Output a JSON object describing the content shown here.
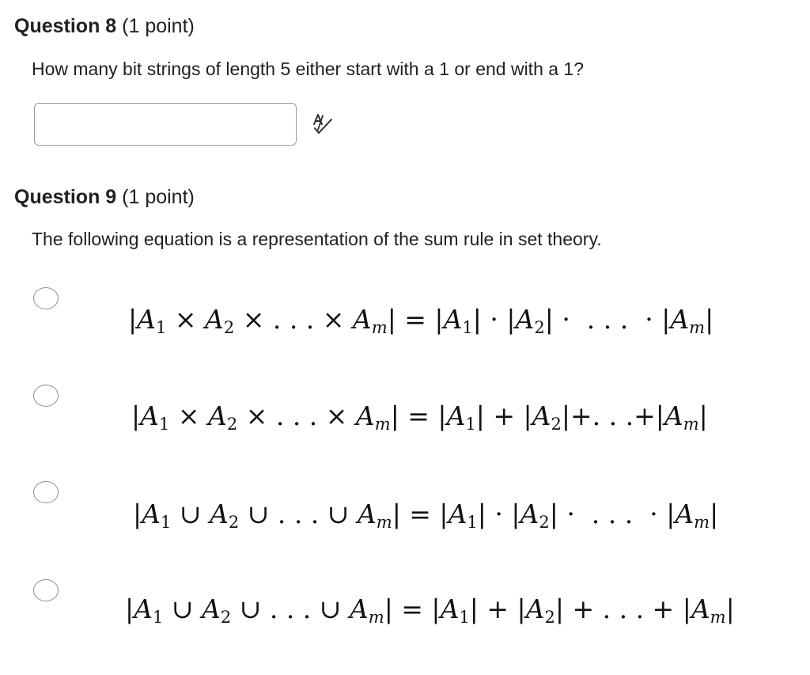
{
  "question8": {
    "number": "Question 8",
    "points": "(1 point)",
    "text": "How many bit strings of length 5 either start with a 1 or end with a 1?",
    "answer_value": "",
    "answer_placeholder": "",
    "spellcheck_icon": "spellcheck-icon"
  },
  "question9": {
    "number": "Question 9",
    "points": "(1 point)",
    "text": "The following equation is a representation of the sum rule in set theory.",
    "options": [
      {
        "selected": false,
        "formula": "|A1 × A2 × ... × Am| = |A1| · |A2| · ... · |Am|"
      },
      {
        "selected": false,
        "formula": "|A1 × A2 × ... × Am| = |A1| + |A2| + ... + |Am|"
      },
      {
        "selected": false,
        "formula": "|A1 ∪ A2 ∪ ... ∪ Am| = |A1| · |A2| · ... · |Am|"
      },
      {
        "selected": false,
        "formula": "|A1 ∪ A2 ∪ ... ∪ Am| = |A1| + |A2| + ... + |Am|"
      }
    ]
  }
}
